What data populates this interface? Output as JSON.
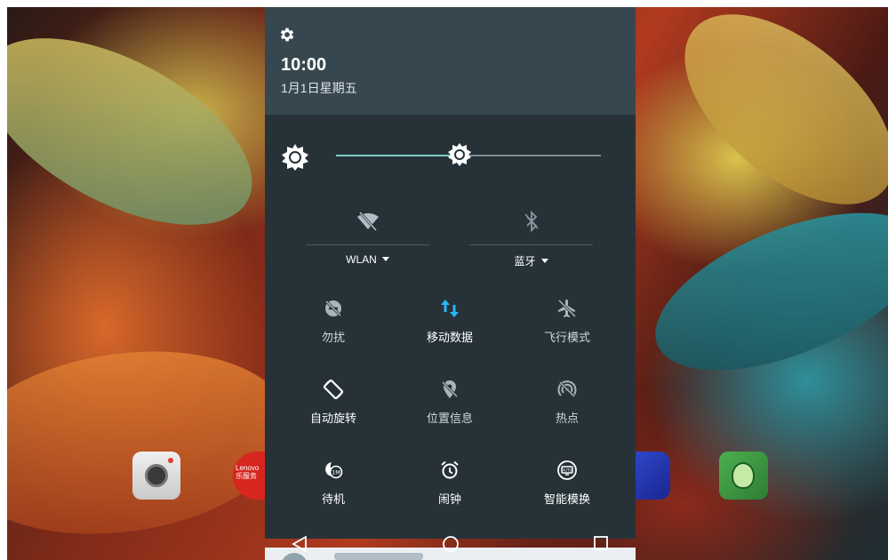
{
  "header": {
    "time": "10:00",
    "date": "1月1日星期五"
  },
  "brightness": {
    "level": 0.46
  },
  "big_tiles": [
    {
      "id": "wlan",
      "label": "WLAN",
      "icon": "wifi-off-icon",
      "active": false
    },
    {
      "id": "bt",
      "label": "蓝牙",
      "icon": "bluetooth-off-icon",
      "active": false
    }
  ],
  "tiles": [
    {
      "label": "勿扰",
      "icon": "do-not-disturb-off-icon",
      "active": false
    },
    {
      "label": "移动数据",
      "icon": "mobile-data-icon",
      "active": true
    },
    {
      "label": "飞行模式",
      "icon": "airplane-mode-off-icon",
      "active": false
    },
    {
      "label": "自动旋转",
      "icon": "auto-rotate-icon",
      "active": true
    },
    {
      "label": "位置信息",
      "icon": "location-off-icon",
      "active": false
    },
    {
      "label": "热点",
      "icon": "hotspot-off-icon",
      "active": false
    },
    {
      "label": "待机",
      "icon": "standby-icon",
      "active": true
    },
    {
      "label": "闹钟",
      "icon": "alarm-clock-icon",
      "active": true
    },
    {
      "label": "智能模换",
      "icon": "smart-mode-icon",
      "active": true
    }
  ],
  "dock_apps": [
    {
      "name": "camera-app-icon",
      "text": ""
    },
    {
      "name": "lenovo-app-icon",
      "text": "Lenovo 乐服务"
    },
    {
      "name": "blue-app-icon",
      "text": ""
    },
    {
      "name": "green-app-icon",
      "text": ""
    }
  ],
  "colors": {
    "shade_bg": "#263238",
    "header_bg": "#37474f",
    "accent": "#80cbc4",
    "active_icon_blue": "#29b6f6"
  },
  "navbar": {
    "back": "back-icon",
    "home": "home-icon",
    "recents": "recents-icon"
  }
}
